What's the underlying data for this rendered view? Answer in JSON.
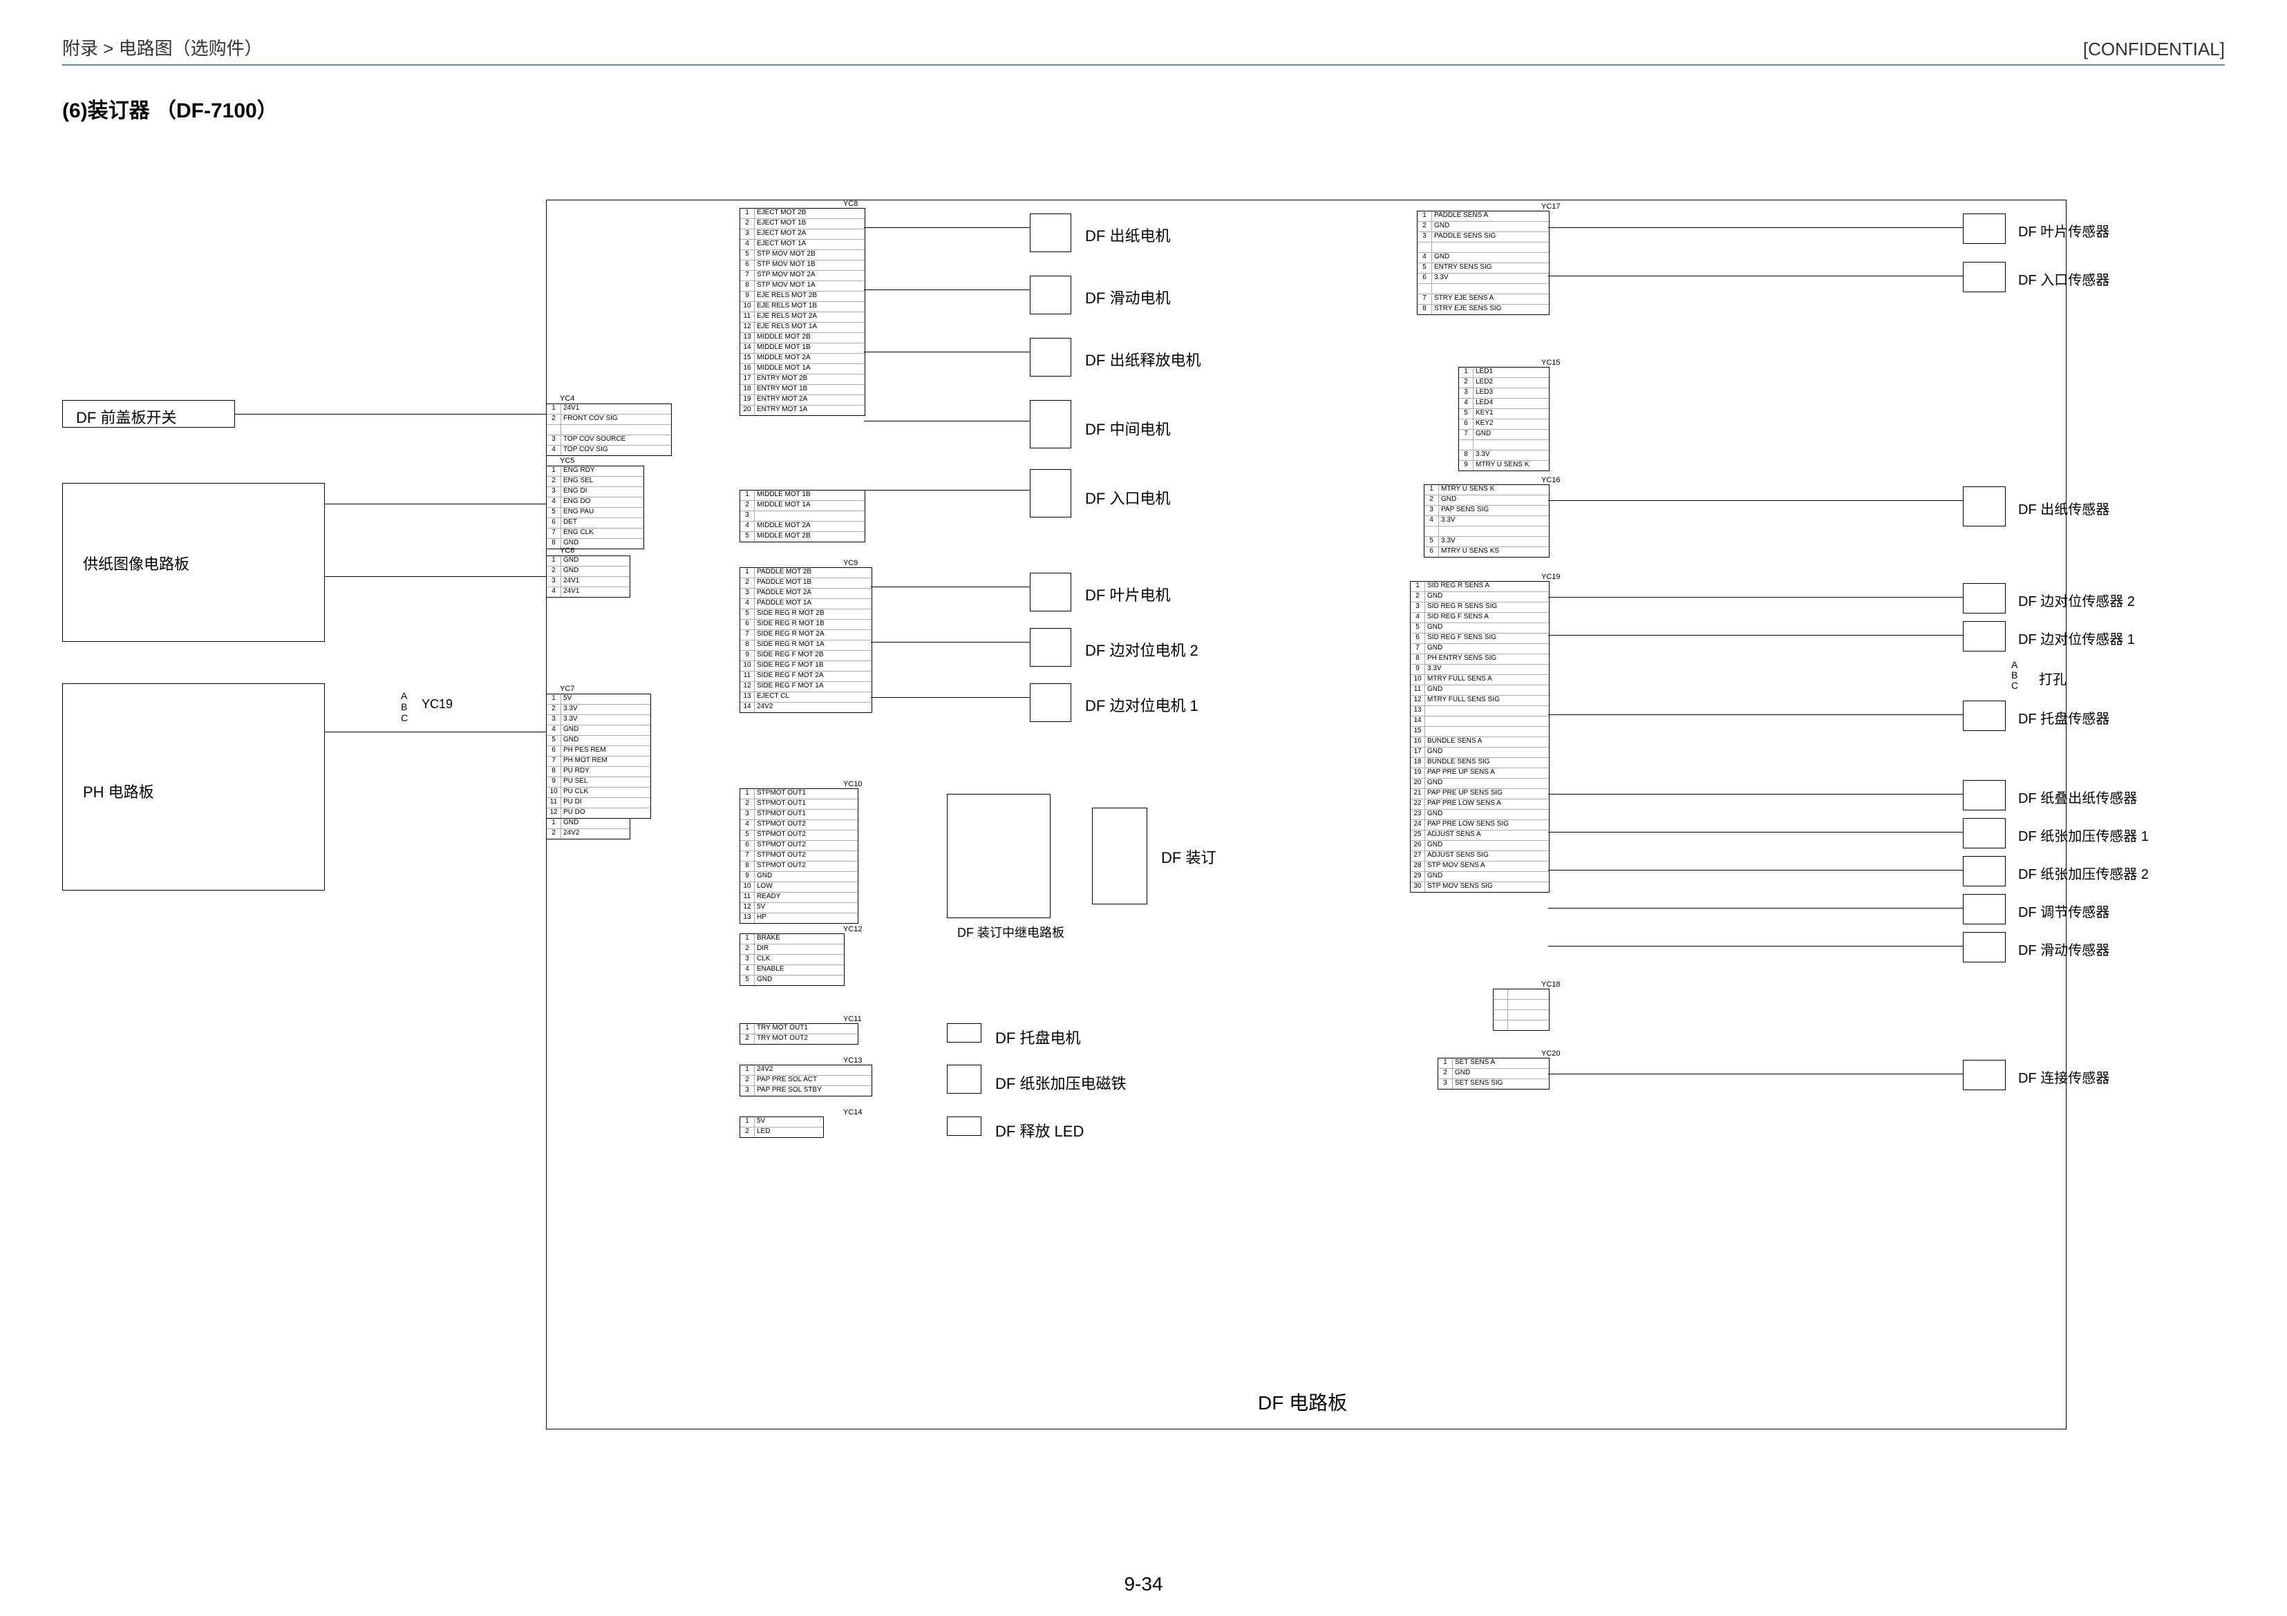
{
  "header": {
    "breadcrumb": "附录 > 电路图（选购件）",
    "confidential": "[CONFIDENTIAL]"
  },
  "title": "(6)装订器 （DF-7100）",
  "pageNumber": "9-34",
  "blocks": {
    "dfFrontCoverSw": "DF 前盖板开关",
    "paperFeedImagePwb": "供纸图像电路板",
    "phPwb": "PH 电路板",
    "dfPwb": "DF 电路板",
    "dfStapleRelayPwb": "DF 装订中继电路板"
  },
  "motors": {
    "eject": "DF 出纸电机",
    "slide": "DF 滑动电机",
    "ejectRelease": "DF 出纸释放电机",
    "middle": "DF 中间电机",
    "entry": "DF 入口电机",
    "paddle": "DF 叶片电机",
    "sideReg2": "DF 边对位电机 2",
    "sideReg1": "DF 边对位电机 1",
    "staple": "DF 装订",
    "tray": "DF 托盘电机"
  },
  "solenoids": {
    "paperPress": "DF 纸张加压电磁铁",
    "releaseLed": "DF 释放 LED"
  },
  "sensors": {
    "paddle": "DF 叶片传感器",
    "entry": "DF 入口传感器",
    "eject": "DF 出纸传感器",
    "sideReg2": "DF 边对位传感器 2",
    "sideReg1": "DF 边对位传感器 1",
    "punch": "打孔",
    "tray": "DF 托盘传感器",
    "bundleEject": "DF 纸叠出纸传感器",
    "paperPress1": "DF 纸张加压传感器 1",
    "paperPress2": "DF 纸张加压传感器 2",
    "adjust": "DF 调节传感器",
    "slide": "DF 滑动传感器",
    "set": "DF 连接传感器"
  },
  "connectors": {
    "yc4": "YC4",
    "yc5": "YC5",
    "yc6": "YC6",
    "yc7": "YC7",
    "yc8": "YC8",
    "yc9": "YC9",
    "yc10": "YC10",
    "yc11": "YC11",
    "yc12": "YC12",
    "yc13": "YC13",
    "yc14": "YC14",
    "yc15": "YC15",
    "yc16": "YC16",
    "yc17": "YC17",
    "yc18": "YC18",
    "yc19": "YC19",
    "yc20": "YC20"
  },
  "abc": {
    "a": "A",
    "b": "B",
    "c": "C"
  },
  "yc4_pins": [
    {
      "n": "1",
      "t": "24V1"
    },
    {
      "n": "2",
      "t": "FRONT COV SIG"
    },
    {
      "n": "",
      "t": ""
    },
    {
      "n": "3",
      "t": "TOP COV SOURCE"
    },
    {
      "n": "4",
      "t": "TOP COV SIG"
    }
  ],
  "yc5_pins": [
    {
      "n": "1",
      "t": "ENG RDY"
    },
    {
      "n": "2",
      "t": "ENG SEL"
    },
    {
      "n": "3",
      "t": "ENG DI"
    },
    {
      "n": "4",
      "t": "ENG DO"
    },
    {
      "n": "5",
      "t": "ENG PAU"
    },
    {
      "n": "6",
      "t": "DET"
    },
    {
      "n": "7",
      "t": "ENG CLK"
    },
    {
      "n": "8",
      "t": "GND"
    }
  ],
  "yc6_pins": [
    {
      "n": "1",
      "t": "GND"
    },
    {
      "n": "2",
      "t": "GND"
    },
    {
      "n": "3",
      "t": "24V1"
    },
    {
      "n": "4",
      "t": "24V1"
    }
  ],
  "yc7_pins": [
    {
      "n": "1",
      "t": "5V"
    },
    {
      "n": "2",
      "t": "3.3V"
    },
    {
      "n": "3",
      "t": "3.3V"
    },
    {
      "n": "4",
      "t": "GND"
    },
    {
      "n": "5",
      "t": "GND"
    },
    {
      "n": "6",
      "t": "PH PES REM"
    },
    {
      "n": "7",
      "t": "PH MOT REM"
    },
    {
      "n": "8",
      "t": "PU RDY"
    },
    {
      "n": "9",
      "t": "PU SEL"
    },
    {
      "n": "10",
      "t": "PU CLK"
    },
    {
      "n": "11",
      "t": "PU DI"
    },
    {
      "n": "12",
      "t": "PU DO"
    }
  ],
  "yc7b_pins": [
    {
      "n": "1",
      "t": "GND"
    },
    {
      "n": "2",
      "t": "24V2"
    }
  ],
  "yc8_pins": [
    {
      "n": "1",
      "t": "EJECT MOT 2B"
    },
    {
      "n": "2",
      "t": "EJECT MOT 1B"
    },
    {
      "n": "3",
      "t": "EJECT MOT 2A"
    },
    {
      "n": "4",
      "t": "EJECT MOT 1A"
    },
    {
      "n": "5",
      "t": "STP MOV MOT 2B"
    },
    {
      "n": "6",
      "t": "STP MOV MOT 1B"
    },
    {
      "n": "7",
      "t": "STP MOV MOT 2A"
    },
    {
      "n": "8",
      "t": "STP MOV MOT 1A"
    },
    {
      "n": "9",
      "t": "EJE RELS MOT 2B"
    },
    {
      "n": "10",
      "t": "EJE RELS MOT 1B"
    },
    {
      "n": "11",
      "t": "EJE RELS MOT 2A"
    },
    {
      "n": "12",
      "t": "EJE RELS MOT 1A"
    },
    {
      "n": "13",
      "t": "MIDDLE MOT 2B"
    },
    {
      "n": "14",
      "t": "MIDDLE MOT 1B"
    },
    {
      "n": "15",
      "t": "MIDDLE MOT 2A"
    },
    {
      "n": "16",
      "t": "MIDDLE MOT 1A"
    },
    {
      "n": "17",
      "t": "ENTRY MOT 2B"
    },
    {
      "n": "18",
      "t": "ENTRY MOT 1B"
    },
    {
      "n": "19",
      "t": "ENTRY MOT 2A"
    },
    {
      "n": "20",
      "t": "ENTRY MOT 1A"
    }
  ],
  "yc8b_pins": [
    {
      "n": "1",
      "t": "MIDDLE MOT 1B"
    },
    {
      "n": "2",
      "t": "MIDDLE MOT 1A"
    },
    {
      "n": "3",
      "t": ""
    },
    {
      "n": "4",
      "t": "MIDDLE MOT 2A"
    },
    {
      "n": "5",
      "t": "MIDDLE MOT 2B"
    }
  ],
  "yc9_pins": [
    {
      "n": "1",
      "t": "PADDLE MOT 2B"
    },
    {
      "n": "2",
      "t": "PADDLE MOT 1B"
    },
    {
      "n": "3",
      "t": "PADDLE MOT 2A"
    },
    {
      "n": "4",
      "t": "PADDLE MOT 1A"
    },
    {
      "n": "5",
      "t": "SIDE REG R MOT 2B"
    },
    {
      "n": "6",
      "t": "SIDE REG R MOT 1B"
    },
    {
      "n": "7",
      "t": "SIDE REG R MOT 2A"
    },
    {
      "n": "8",
      "t": "SIDE REG R MOT 1A"
    },
    {
      "n": "9",
      "t": "SIDE REG F MOT 2B"
    },
    {
      "n": "10",
      "t": "SIDE REG F MOT 1B"
    },
    {
      "n": "11",
      "t": "SIDE REG F MOT 2A"
    },
    {
      "n": "12",
      "t": "SIDE REG F MOT 1A"
    },
    {
      "n": "13",
      "t": "EJECT CL"
    },
    {
      "n": "14",
      "t": "24V2"
    }
  ],
  "yc10_pins": [
    {
      "n": "1",
      "t": "STPMOT OUT1"
    },
    {
      "n": "2",
      "t": "STPMOT OUT1"
    },
    {
      "n": "3",
      "t": "STPMOT OUT1"
    },
    {
      "n": "4",
      "t": "STPMOT OUT2"
    },
    {
      "n": "5",
      "t": "STPMOT OUT2"
    },
    {
      "n": "6",
      "t": "STPMOT OUT2"
    },
    {
      "n": "7",
      "t": "STPMOT OUT2"
    },
    {
      "n": "8",
      "t": "STPMOT OUT2"
    },
    {
      "n": "9",
      "t": "GND"
    },
    {
      "n": "10",
      "t": "LOW"
    },
    {
      "n": "11",
      "t": "READY"
    },
    {
      "n": "12",
      "t": "5V"
    },
    {
      "n": "13",
      "t": "HP"
    }
  ],
  "yc11_pins": [
    {
      "n": "1",
      "t": "TRY MOT OUT1"
    },
    {
      "n": "2",
      "t": "TRY MOT OUT2"
    }
  ],
  "yc12_pins": [
    {
      "n": "1",
      "t": "BRAKE"
    },
    {
      "n": "2",
      "t": "DIR"
    },
    {
      "n": "3",
      "t": "CLK"
    },
    {
      "n": "4",
      "t": "ENABLE"
    },
    {
      "n": "5",
      "t": "GND"
    }
  ],
  "yc13_pins": [
    {
      "n": "1",
      "t": "24V2"
    },
    {
      "n": "2",
      "t": "PAP PRE SOL ACT"
    },
    {
      "n": "3",
      "t": "PAP PRE SOL STBY"
    }
  ],
  "yc14_pins": [
    {
      "n": "1",
      "t": "5V"
    },
    {
      "n": "2",
      "t": "LED"
    }
  ],
  "yc15_pins": [
    {
      "n": "1",
      "t": "LED1"
    },
    {
      "n": "2",
      "t": "LED2"
    },
    {
      "n": "3",
      "t": "LED3"
    },
    {
      "n": "4",
      "t": "LED4"
    },
    {
      "n": "5",
      "t": "KEY1"
    },
    {
      "n": "6",
      "t": "KEY2"
    },
    {
      "n": "7",
      "t": "GND"
    },
    {
      "n": "",
      "t": ""
    },
    {
      "n": "8",
      "t": "3.3V"
    },
    {
      "n": "9",
      "t": "MTRY U SENS K"
    }
  ],
  "yc16_pins": [
    {
      "n": "1",
      "t": "MTRY U SENS K"
    },
    {
      "n": "2",
      "t": "GND"
    },
    {
      "n": "3",
      "t": "PAP SENS SIG"
    },
    {
      "n": "4",
      "t": "3.3V"
    },
    {
      "n": "",
      "t": ""
    },
    {
      "n": "5",
      "t": "3.3V"
    },
    {
      "n": "6",
      "t": "MTRY U SENS KS"
    }
  ],
  "yc17_pins": [
    {
      "n": "1",
      "t": "PADDLE SENS A"
    },
    {
      "n": "2",
      "t": "GND"
    },
    {
      "n": "3",
      "t": "PADDLE SENS SIG"
    },
    {
      "n": "",
      "t": ""
    },
    {
      "n": "4",
      "t": "GND"
    },
    {
      "n": "5",
      "t": "ENTRY SENS SIG"
    },
    {
      "n": "6",
      "t": "3.3V"
    },
    {
      "n": "",
      "t": ""
    },
    {
      "n": "7",
      "t": "STRY EJE SENS A"
    },
    {
      "n": "8",
      "t": "STRY EJE SENS SIG"
    }
  ],
  "yc18_pins": [
    {
      "n": "",
      "t": ""
    },
    {
      "n": "",
      "t": ""
    },
    {
      "n": "",
      "t": ""
    },
    {
      "n": "",
      "t": ""
    }
  ],
  "yc19_pins": [
    {
      "n": "1",
      "t": "SID REG R SENS A"
    },
    {
      "n": "2",
      "t": "GND"
    },
    {
      "n": "3",
      "t": "SID REG R SENS SIG"
    },
    {
      "n": "4",
      "t": "SID REG F SENS A"
    },
    {
      "n": "5",
      "t": "GND"
    },
    {
      "n": "6",
      "t": "SID REG F SENS SIG"
    },
    {
      "n": "7",
      "t": "GND"
    },
    {
      "n": "8",
      "t": "PH ENTRY SENS SIG"
    },
    {
      "n": "9",
      "t": "3.3V"
    },
    {
      "n": "10",
      "t": "MTRY FULL SENS A"
    },
    {
      "n": "11",
      "t": "GND"
    },
    {
      "n": "12",
      "t": "MTRY FULL SENS SIG"
    },
    {
      "n": "13",
      "t": ""
    },
    {
      "n": "14",
      "t": ""
    },
    {
      "n": "15",
      "t": ""
    },
    {
      "n": "16",
      "t": "BUNDLE SENS A"
    },
    {
      "n": "17",
      "t": "GND"
    },
    {
      "n": "18",
      "t": "BUNDLE SENS SIG"
    },
    {
      "n": "19",
      "t": "PAP PRE UP SENS A"
    },
    {
      "n": "20",
      "t": "GND"
    },
    {
      "n": "21",
      "t": "PAP PRE UP SENS SIG"
    },
    {
      "n": "22",
      "t": "PAP PRE LOW SENS A"
    },
    {
      "n": "23",
      "t": "GND"
    },
    {
      "n": "24",
      "t": "PAP PRE LOW SENS SIG"
    },
    {
      "n": "25",
      "t": "ADJUST SENS A"
    },
    {
      "n": "26",
      "t": "GND"
    },
    {
      "n": "27",
      "t": "ADJUST SENS SIG"
    },
    {
      "n": "28",
      "t": "STP MOV SENS A"
    },
    {
      "n": "29",
      "t": "GND"
    },
    {
      "n": "30",
      "t": "STP MOV SENS SIG"
    }
  ],
  "yc20_pins": [
    {
      "n": "1",
      "t": "SET SENS A"
    },
    {
      "n": "2",
      "t": "GND"
    },
    {
      "n": "3",
      "t": "SET SENS SIG"
    }
  ]
}
